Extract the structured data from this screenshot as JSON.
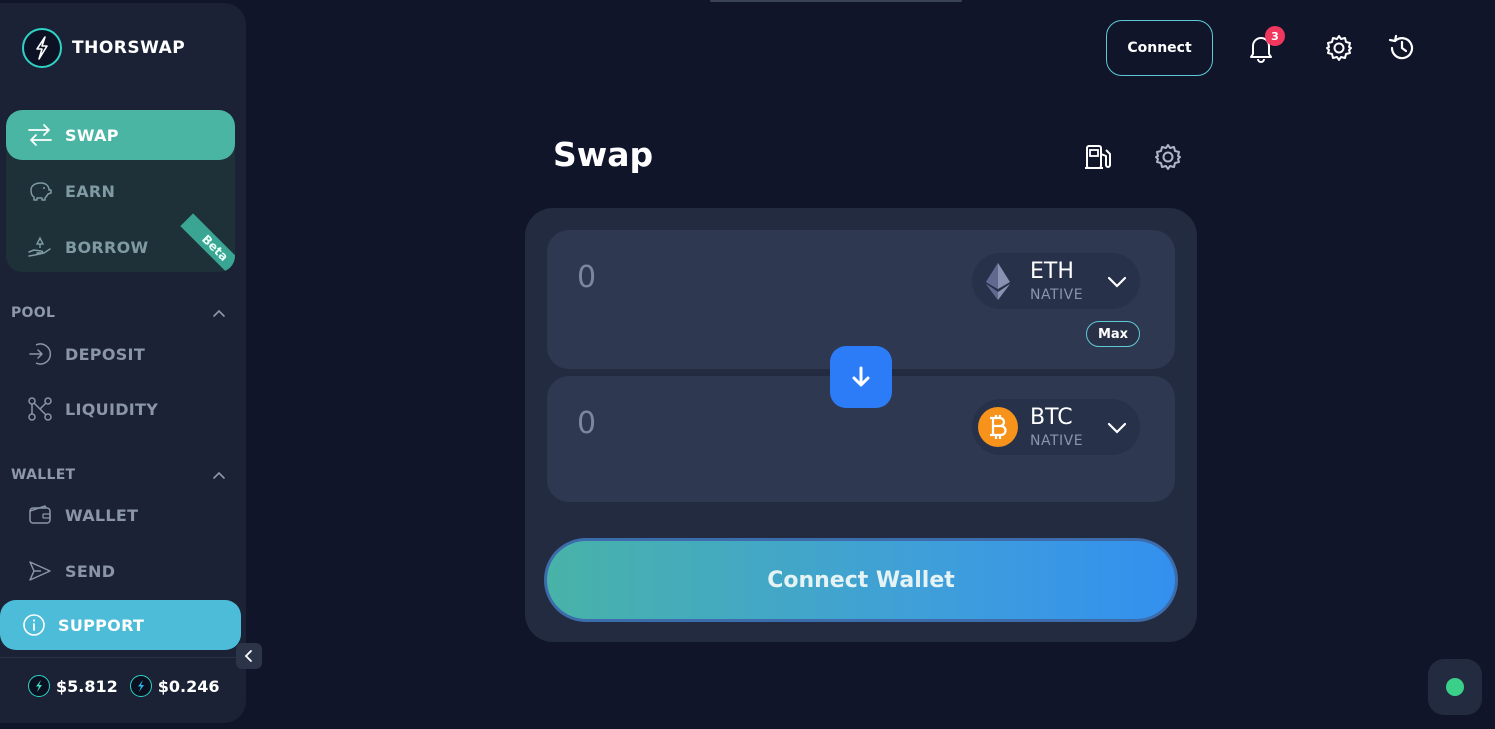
{
  "brand": {
    "name": "THORSWAP"
  },
  "sidebar": {
    "main": [
      {
        "label": "SWAP",
        "icon": "swap-arrows-icon"
      },
      {
        "label": "EARN",
        "icon": "piggy-bank-icon"
      },
      {
        "label": "BORROW",
        "icon": "hand-coin-icon",
        "tag": "Beta"
      }
    ],
    "pool": {
      "title": "POOL",
      "items": [
        {
          "label": "DEPOSIT",
          "icon": "deposit-icon"
        },
        {
          "label": "LIQUIDITY",
          "icon": "liquidity-icon"
        }
      ]
    },
    "wallet": {
      "title": "WALLET",
      "items": [
        {
          "label": "WALLET",
          "icon": "wallet-icon"
        },
        {
          "label": "SEND",
          "icon": "send-icon"
        }
      ]
    },
    "support": {
      "label": "SUPPORT",
      "icon": "info-icon"
    },
    "prices": [
      {
        "value": "$5.812",
        "icon": "rune-icon"
      },
      {
        "value": "$0.246",
        "icon": "thor-icon"
      }
    ]
  },
  "header": {
    "connect_label": "Connect",
    "notifications_count": "3"
  },
  "swap": {
    "title": "Swap",
    "input": {
      "amount": "0",
      "symbol": "ETH",
      "chain": "NATIVE",
      "max_label": "Max"
    },
    "output": {
      "amount": "0",
      "symbol": "BTC",
      "chain": "NATIVE"
    },
    "connect_wallet_label": "Connect Wallet"
  },
  "colors": {
    "accent": "#4bb5a4",
    "support": "#4cbcd8",
    "flip_button": "#2b7cf6",
    "status_online": "#3ad08a",
    "badge": "#f0375e"
  }
}
